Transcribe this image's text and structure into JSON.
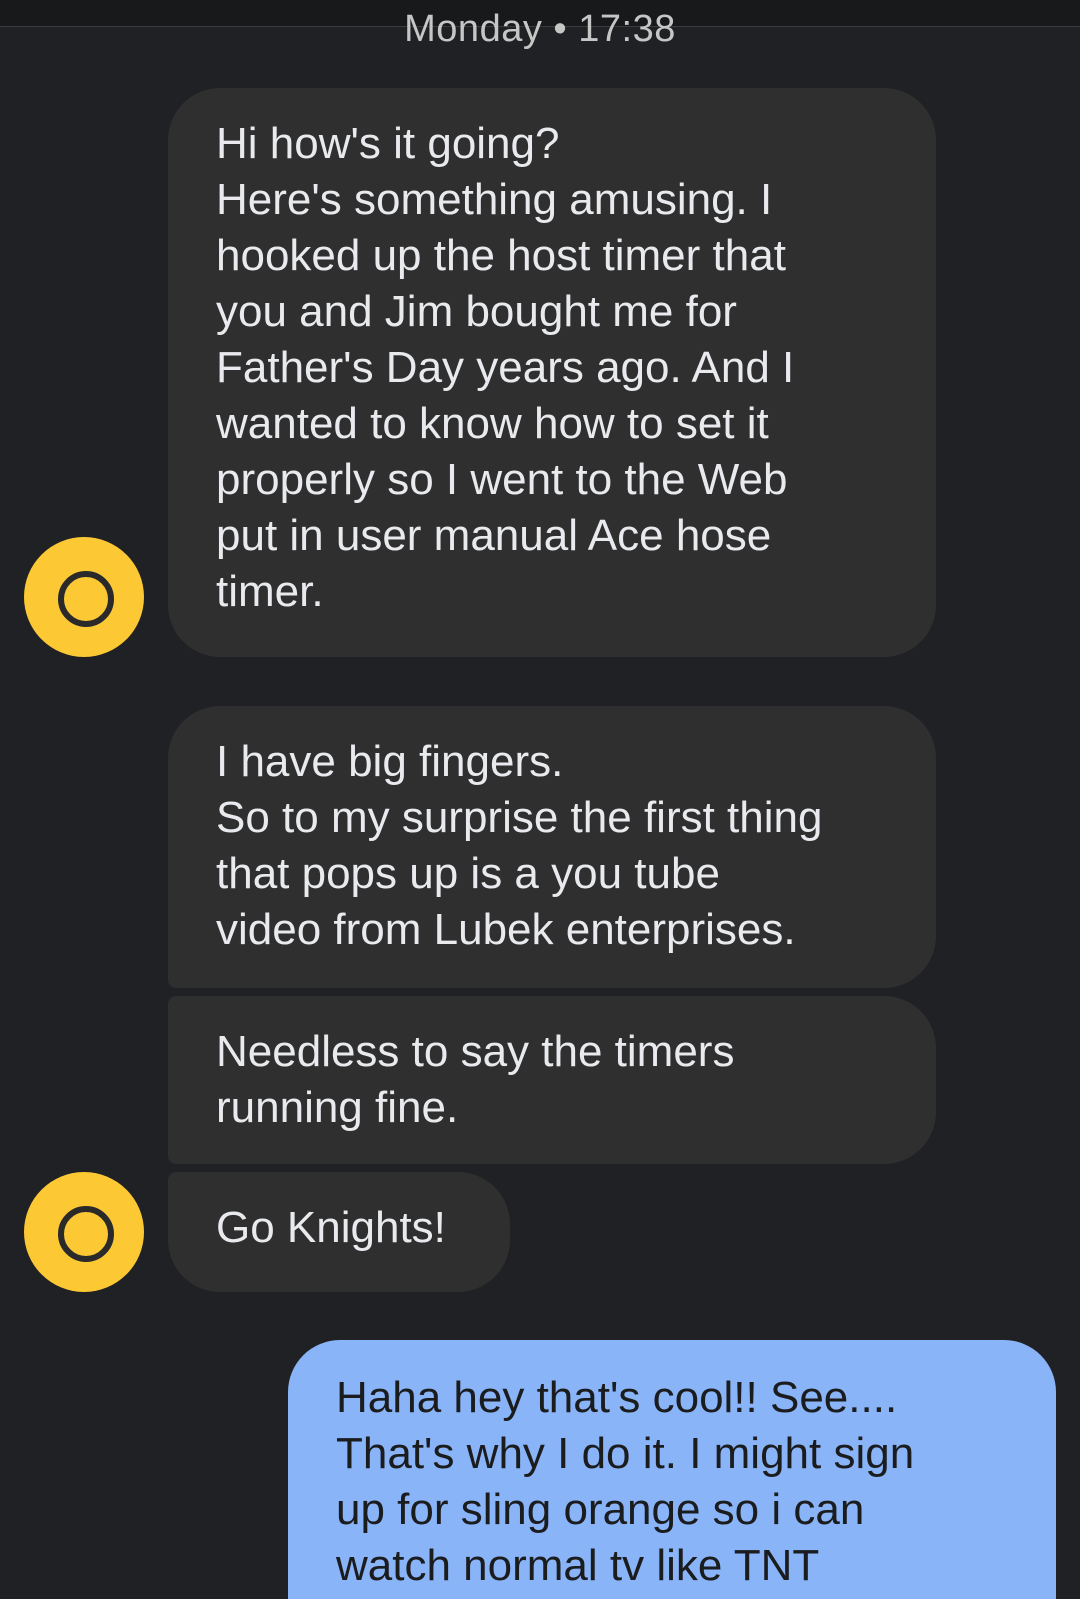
{
  "conversation": {
    "timestamp": "Monday • 17:38",
    "messages": [
      {
        "direction": "incoming",
        "lines": [
          "Hi how's it going?",
          "Here's something amusing. I",
          "hooked up the host timer that",
          "you and Jim bought me for",
          "Father's Day years ago. And I",
          "wanted to know how to set it",
          "properly so I went to the Web",
          "put in user manual Ace hose",
          "timer."
        ]
      },
      {
        "direction": "incoming",
        "lines": [
          "I have big fingers.",
          "So to my surprise the first thing",
          "that pops up is a you tube",
          "video from Lubek enterprises."
        ]
      },
      {
        "direction": "incoming",
        "lines": [
          "Needless to say the timers",
          "running fine."
        ]
      },
      {
        "direction": "incoming",
        "lines": [
          "Go Knights!"
        ]
      },
      {
        "direction": "outgoing",
        "lines": [
          "Haha hey that's cool!! See....",
          "That's why I do it. I might sign",
          "up for sling orange so i can",
          "watch normal tv like TNT"
        ]
      }
    ]
  },
  "colors": {
    "background": "#202124",
    "incoming_bubble": "#2f2f2f",
    "outgoing_bubble": "#8ab4f8",
    "avatar": "#fcc934"
  },
  "icons": {
    "avatar": "contact-avatar-icon"
  }
}
